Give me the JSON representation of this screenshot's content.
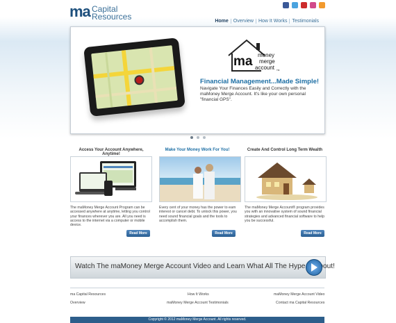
{
  "brand": {
    "logo_mark": "ma",
    "logo_line1": "Capital",
    "logo_line2": "Resources"
  },
  "social": [
    {
      "name": "facebook-icon",
      "color": "#3b5998"
    },
    {
      "name": "twitter-icon",
      "color": "#4aa3df"
    },
    {
      "name": "youtube-icon",
      "color": "#cc2b2b"
    },
    {
      "name": "flickr-icon",
      "color": "#d14a8b"
    },
    {
      "name": "rss-icon",
      "color": "#f29a2e"
    }
  ],
  "nav": [
    "Home",
    "Overview",
    "How It Works",
    "Testimonials"
  ],
  "hero": {
    "logo_mark": "ma",
    "logo_text1": "money",
    "logo_text2": "merge",
    "logo_text3": "account",
    "logo_tm": "TM",
    "headline": "Financial Management...Made Simple!",
    "body": "Navigate Your Finances Easily and Correctly with the maMoney Merge Account.  It's like your own personal \"financial GPS\"."
  },
  "columns": [
    {
      "heading": "Access Your Account Anywhere, Anytime!",
      "text": "The maMoney Merge Account Program can be accessed anywhere at anytime, letting you control your finances wherever you are. All you need is access to the internet via a computer or mobile device.",
      "button": "Read More"
    },
    {
      "heading": "Make Your Money Work For You!",
      "text": "Every cent of your money has the power to earn interest or cancel debt. To unlock this power, you need sound financial goals and the tools to accomplish them.",
      "button": "Read More"
    },
    {
      "heading": "Create And Control Long Term Wealth",
      "text": "The maMoney Merge Account® program provides you with an innovative system of sound financial strategies and advanced financial software to help you be successful.",
      "button": "Read More"
    }
  ],
  "video_banner": "Watch The maMoney Merge Account Video and Learn What All The Hype Is About!",
  "footer": {
    "links": [
      "ma Capital Resources",
      "How It Works",
      "maMoney Merge Account Video",
      "Overview",
      "maMoney Merge Account Testimonials",
      "Contact ma Capital Resources"
    ],
    "copyright": "Copyright © 2012 maMoney Merge Account. All rights reserved."
  }
}
